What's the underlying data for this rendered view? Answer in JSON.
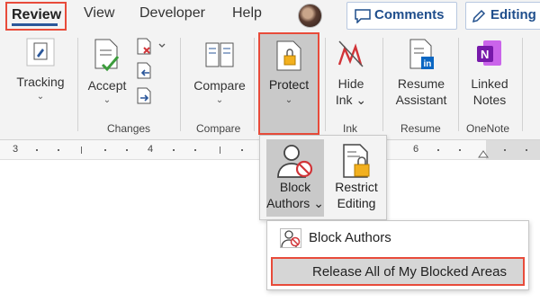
{
  "tabs": {
    "review": "Review",
    "view": "View",
    "developer": "Developer",
    "help": "Help",
    "comments": "Comments",
    "editing": "Editing"
  },
  "ribbon": {
    "tracking": "Tracking",
    "accept": "Accept",
    "compare": "Compare",
    "protect": "Protect",
    "hide_ink_1": "Hide",
    "hide_ink_2": "Ink",
    "resume_1": "Resume",
    "resume_2": "Assistant",
    "linked_1": "Linked",
    "linked_2": "Notes",
    "groups": {
      "changes": "Changes",
      "compare": "Compare",
      "ink": "Ink",
      "resume": "Resume",
      "onenote": "OneNote"
    }
  },
  "ruler": {
    "n3": "3",
    "n4": "4",
    "n6": "6"
  },
  "protect_menu": {
    "block_1": "Block",
    "block_2": "Authors",
    "restrict_1": "Restrict",
    "restrict_2": "Editing"
  },
  "block_submenu": {
    "block_authors": "Block Authors",
    "release_all": "Release All of My Blocked Areas"
  },
  "colors": {
    "highlight": "#e84b3a",
    "accent": "#2b579a",
    "onenote": "#7719aa",
    "linkedin": "#0a66c2"
  }
}
